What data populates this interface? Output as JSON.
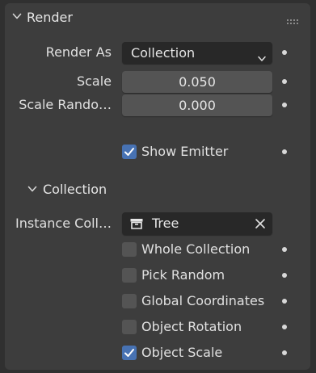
{
  "render_panel": {
    "title": "Render",
    "render_as": {
      "label": "Render As",
      "value": "Collection"
    },
    "scale": {
      "label": "Scale",
      "value": "0.050"
    },
    "scale_random": {
      "label": "Scale Rando…",
      "value": "0.000"
    },
    "show_emitter": {
      "label": "Show Emitter",
      "checked": true
    }
  },
  "collection_panel": {
    "title": "Collection",
    "instance_collection": {
      "label": "Instance Coll…",
      "value": "Tree"
    },
    "options": [
      {
        "label": "Whole Collection",
        "checked": false
      },
      {
        "label": "Pick Random",
        "checked": false
      },
      {
        "label": "Global Coordinates",
        "checked": false
      },
      {
        "label": "Object Rotation",
        "checked": false
      },
      {
        "label": "Object Scale",
        "checked": true
      }
    ]
  },
  "colors": {
    "background": "#303030",
    "panel": "#3d3d3d",
    "field_dark": "#282828",
    "field_number": "#545454",
    "checkbox_on": "#4772b3",
    "text": "#e0e0e0"
  },
  "icons": {
    "expand": "chevron-down-icon",
    "grip": "drag-grip-icon",
    "dropdown": "dropdown-arrow-icon",
    "collection": "collection-box-icon",
    "clear": "close-icon",
    "keyframe": "keyframe-dot-icon",
    "check": "checkmark-icon"
  }
}
